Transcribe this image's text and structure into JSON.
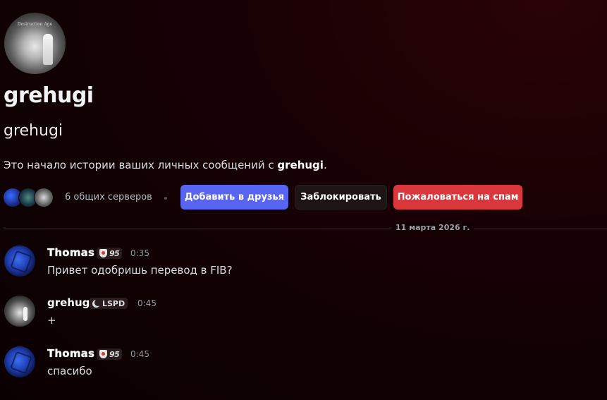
{
  "profile": {
    "avatar_caption": "Destruction Age",
    "display_name": "grehugi",
    "username": "grehugi",
    "intro_prefix": "Это начало истории ваших личных сообщений с ",
    "intro_name": "grehugi",
    "intro_suffix": "."
  },
  "mutual": {
    "servers_text": "6 общих серверов"
  },
  "actions": {
    "add_friend": "Добавить в друзья",
    "block": "Заблокировать",
    "report_spam": "Пожаловаться на спам"
  },
  "divider": {
    "date": "11 марта 2026 г."
  },
  "messages": [
    {
      "author": "Thomas",
      "tag": "95",
      "time": "0:35",
      "text": "Привет одобришь перевод в FIB?"
    },
    {
      "author": "grehugi",
      "tag": "LSPD",
      "time": "0:45",
      "text": "+"
    },
    {
      "author": "Thomas",
      "tag": "95",
      "time": "0:45",
      "text": "спасибо"
    }
  ],
  "icons": {
    "thomas_tag": "shield-icon",
    "grehugi_tag": "moon-icon"
  },
  "colors": {
    "primary_button": "#5865f2",
    "danger_button": "#da373c",
    "background": "#120103"
  }
}
